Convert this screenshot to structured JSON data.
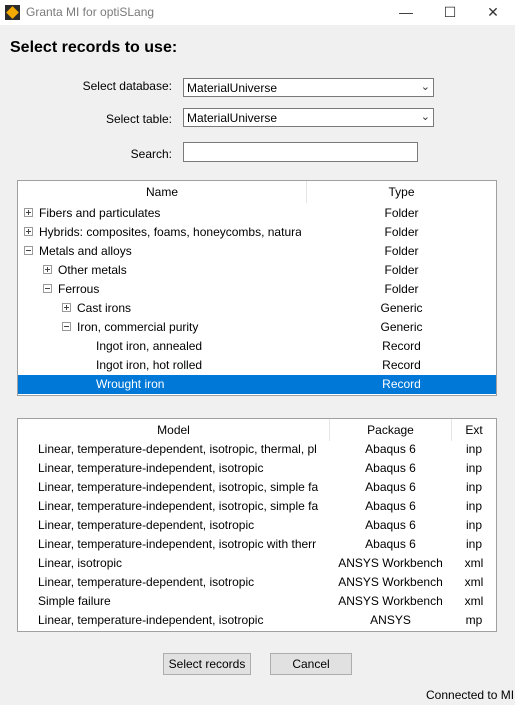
{
  "window": {
    "title": "Granta MI for optiSLang"
  },
  "heading": "Select records to use:",
  "form": {
    "database_label": "Select database:",
    "database_value": "MaterialUniverse",
    "table_label": "Select table:",
    "table_value": "MaterialUniverse",
    "search_label": "Search:",
    "search_value": ""
  },
  "tree": {
    "headers": {
      "name": "Name",
      "type": "Type"
    },
    "rows": [
      {
        "name": "Fibers and particulates",
        "type": "Folder",
        "expander": "+"
      },
      {
        "name": "Hybrids: composites, foams, honeycombs, natural m",
        "type": "Folder",
        "expander": "+"
      },
      {
        "name": "Metals and alloys",
        "type": "Folder",
        "expander": "-"
      },
      {
        "name": "Other metals",
        "type": "Folder",
        "expander": "+"
      },
      {
        "name": "Ferrous",
        "type": "Folder",
        "expander": "-"
      },
      {
        "name": "Cast irons",
        "type": "Generic",
        "expander": "+"
      },
      {
        "name": "Iron, commercial purity",
        "type": "Generic",
        "expander": "-"
      },
      {
        "name": "Ingot iron, annealed",
        "type": "Record",
        "expander": ""
      },
      {
        "name": "Ingot iron, hot rolled",
        "type": "Record",
        "expander": ""
      },
      {
        "name": "Wrought iron",
        "type": "Record",
        "expander": "",
        "selected": true
      }
    ]
  },
  "models": {
    "headers": {
      "model": "Model",
      "package": "Package",
      "ext": "Ext"
    },
    "rows": [
      {
        "model": "Linear, temperature-dependent, isotropic, thermal, pl",
        "package": "Abaqus 6",
        "ext": "inp"
      },
      {
        "model": "Linear, temperature-independent, isotropic",
        "package": "Abaqus 6",
        "ext": "inp"
      },
      {
        "model": "Linear, temperature-independent, isotropic, simple fa",
        "package": "Abaqus 6",
        "ext": "inp"
      },
      {
        "model": "Linear, temperature-independent, isotropic, simple fa",
        "package": "Abaqus 6",
        "ext": "inp"
      },
      {
        "model": "Linear, temperature-dependent, isotropic",
        "package": "Abaqus 6",
        "ext": "inp"
      },
      {
        "model": "Linear, temperature-independent, isotropic with therr",
        "package": "Abaqus 6",
        "ext": "inp"
      },
      {
        "model": "Linear, isotropic",
        "package": "ANSYS Workbench",
        "ext": "xml"
      },
      {
        "model": "Linear, temperature-dependent, isotropic",
        "package": "ANSYS Workbench",
        "ext": "xml"
      },
      {
        "model": "Simple failure",
        "package": "ANSYS Workbench",
        "ext": "xml"
      },
      {
        "model": "Linear, temperature-independent, isotropic",
        "package": "ANSYS",
        "ext": "mp"
      }
    ]
  },
  "buttons": {
    "select": "Select records",
    "cancel": "Cancel"
  },
  "status": "Connected to MI.",
  "colors": {
    "selection": "#0078d7",
    "window_bg": "#f0f0f0"
  }
}
